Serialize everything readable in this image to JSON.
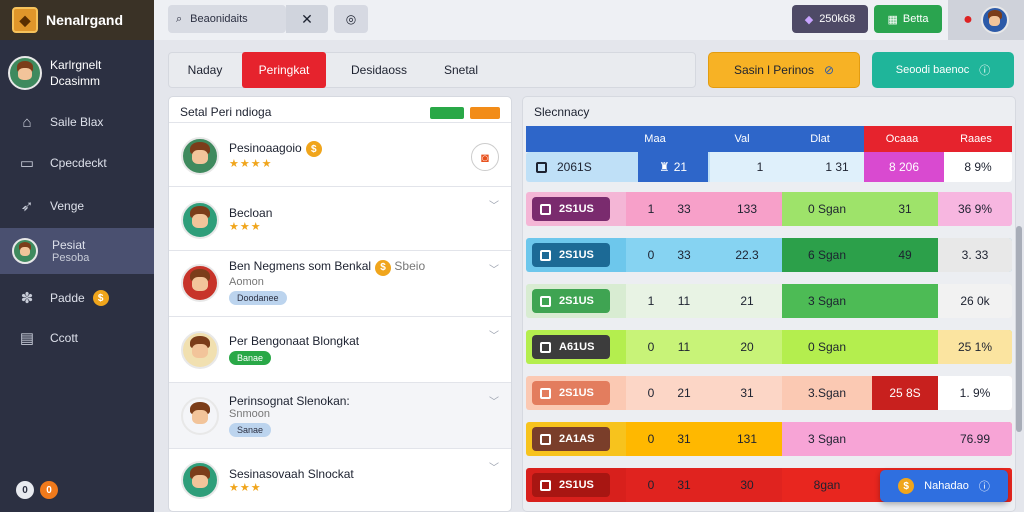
{
  "app": {
    "title": "Nenalrgand"
  },
  "topbar": {
    "search_value": "Beaonidaits",
    "credits": "250k68",
    "status": "Betta"
  },
  "profile": {
    "line1": "Karlrgnelt",
    "line2": "Dcasimm"
  },
  "sidebar": {
    "items": [
      {
        "label": "Saile Blax",
        "icon": "home-icon"
      },
      {
        "label": "Cpecdeckt",
        "icon": "monitor-icon"
      },
      {
        "label": "Venge",
        "icon": "pin-icon"
      },
      {
        "label": "Pesiat",
        "sub": "Pesoba",
        "icon": "avatar"
      },
      {
        "label": "Padde",
        "icon": "puzzle-icon"
      },
      {
        "label": "Ccott",
        "icon": "message-icon"
      }
    ],
    "footer": [
      "0",
      "0"
    ]
  },
  "tabs": [
    "Naday",
    "Peringkat",
    "Desidaoss",
    "Snetal"
  ],
  "actions": {
    "primary": "Sasin l Perinos",
    "secondary": "Seoodi baenoc"
  },
  "players_panel": {
    "title": "Setal Peri ndioga",
    "players": [
      {
        "name": "Pesinoaagoio",
        "stars": "★★★★",
        "badge": ""
      },
      {
        "name": "Becloan",
        "stars": "★★★",
        "badge": ""
      },
      {
        "name": "Ben Negmens som Benkal",
        "extra": "Sbeio",
        "sub": "Aomon",
        "badge": "Doodanee"
      },
      {
        "name": "Per Bengonaat",
        "extra": "Blongkat",
        "badge": "Banae"
      },
      {
        "name": "Perinsognat",
        "extra": "Slenokan:",
        "sub": "Snmoon",
        "badge": "Sanae"
      },
      {
        "name": "Sesinasovaah",
        "extra": "Slnockat",
        "stars": "★★★",
        "badge": ""
      }
    ]
  },
  "standings": {
    "title": "Slecnnacy",
    "columns": [
      "Maa",
      "Val",
      "Dlat",
      "Ocaaa",
      "Raaes"
    ],
    "header_row": {
      "rank": "2061S",
      "a": "21",
      "b": "1",
      "c": "1 31",
      "d": "8 206",
      "e": "8 9%"
    },
    "rows": [
      {
        "rank": "2S1US",
        "a": "1",
        "b": "33",
        "c": "133",
        "d": "0 Sgan",
        "e": "31",
        "f": "36 9%"
      },
      {
        "rank": "2S1US",
        "a": "0",
        "b": "33",
        "c": "22.3",
        "d": "6 Sgan",
        "e": "49",
        "f": "3. 33"
      },
      {
        "rank": "2S1US",
        "a": "1",
        "b": "11",
        "c": "21",
        "d": "3 Sgan",
        "e": "",
        "f": "26 0k"
      },
      {
        "rank": "A61US",
        "a": "0",
        "b": "11",
        "c": "20",
        "d": "0 Sgan",
        "e": "",
        "f": "25 1%"
      },
      {
        "rank": "2S1US",
        "a": "0",
        "b": "21",
        "c": "31",
        "d": "3.Sgan",
        "e": "25 8S",
        "f": "1. 9%"
      },
      {
        "rank": "2A1AS",
        "a": "0",
        "b": "31",
        "c": "131",
        "d": "3 Sgan",
        "e": "",
        "f": "76.99"
      },
      {
        "rank": "2S1US",
        "a": "0",
        "b": "31",
        "c": "30",
        "d": "8gan",
        "e": "",
        "f": ""
      }
    ]
  },
  "toast": {
    "label": "Nahadao"
  }
}
